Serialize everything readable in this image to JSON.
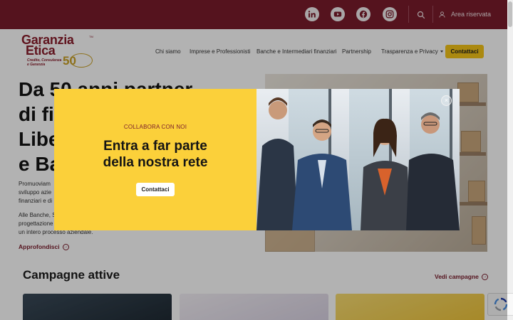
{
  "topbar": {
    "social_icons": [
      "linkedin-icon",
      "youtube-icon",
      "facebook-icon",
      "instagram-icon"
    ],
    "search_icon": "search-icon",
    "area_icon": "user-icon",
    "area_label": "Area riservata"
  },
  "brand": {
    "logo_line1": "Garanzia",
    "logo_line2": "Etica",
    "logo_tagline1": "Credito, Consulenza",
    "logo_tagline2": "e Garanzia",
    "logo_50": "50"
  },
  "nav": {
    "items": [
      "Chi siamo",
      "Imprese e Professionisti",
      "Banche e Intermediari finanziari",
      "Partnership",
      "Trasparenza e Privacy"
    ],
    "cta": "Contattaci"
  },
  "hero": {
    "title_line1": "Da 50 anni partner",
    "title_line2": "di fi",
    "title_line3": "Libe",
    "title_line4": "e Ba",
    "p1_line1": "Promuoviam",
    "p1_line2": "sviluppo azie",
    "p1_line3": "finanziari e di",
    "p2_line1": "Alle Banche, S",
    "p2_line2": "progettazione",
    "p2_line3": "un intero processo aziendale.",
    "link": "Approfondisci"
  },
  "campagne": {
    "title": "Campagne attive",
    "link": "Vedi campagne"
  },
  "modal": {
    "kicker": "COLLABORA CON NOI",
    "title_line1": "Entra a far parte",
    "title_line2": "della nostra rete",
    "button": "Contattaci",
    "close_icon": "close-icon"
  },
  "colors": {
    "brand": "#7a1c2c",
    "accent": "#f5c518",
    "modal_bg": "#fbd03a"
  }
}
